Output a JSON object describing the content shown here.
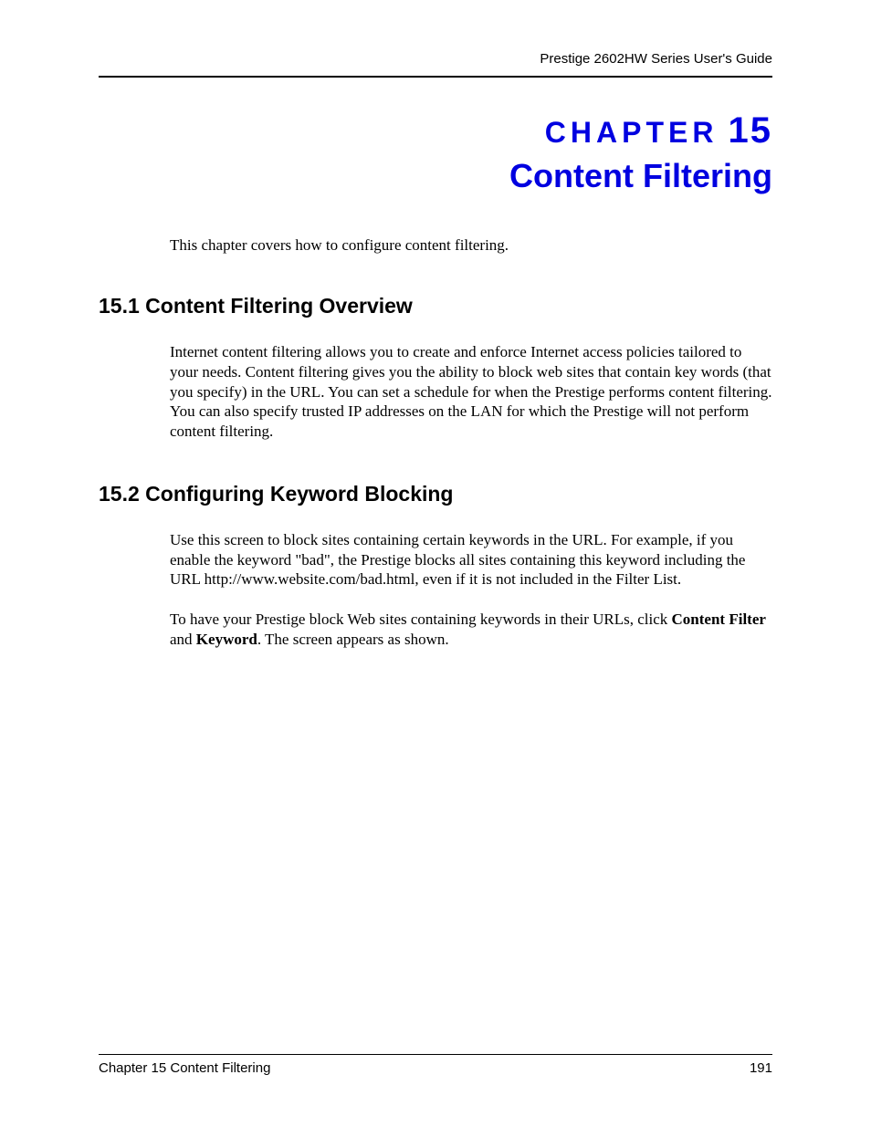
{
  "header": {
    "running": "Prestige 2602HW Series User's Guide"
  },
  "chapter": {
    "label_word": "CHAPTER",
    "label_num": "15",
    "title": "Content Filtering"
  },
  "intro": "This chapter covers how to configure content filtering.",
  "sections": {
    "s1": {
      "heading": "15.1  Content Filtering Overview",
      "p1": "Internet content filtering allows you to create and enforce Internet access policies tailored to your needs. Content filtering gives you the ability to block web sites that contain key words (that you specify) in the URL. You can set a schedule for when the Prestige performs content filtering. You can also specify trusted IP addresses on the LAN for which the Prestige will not perform content filtering."
    },
    "s2": {
      "heading": "15.2  Configuring Keyword Blocking",
      "p1": "Use this screen to block sites containing certain keywords in the URL. For example, if you enable the keyword \"bad\", the Prestige blocks all sites containing this keyword including the URL http://www.website.com/bad.html, even if it is not included in the Filter List.",
      "p2_pre": "To have your Prestige block Web sites containing keywords in their URLs, click ",
      "p2_b1": "Content Filter",
      "p2_mid": " and ",
      "p2_b2": "Keyword",
      "p2_post": ". The screen appears as shown."
    }
  },
  "footer": {
    "left": "Chapter 15 Content Filtering",
    "right": "191"
  }
}
